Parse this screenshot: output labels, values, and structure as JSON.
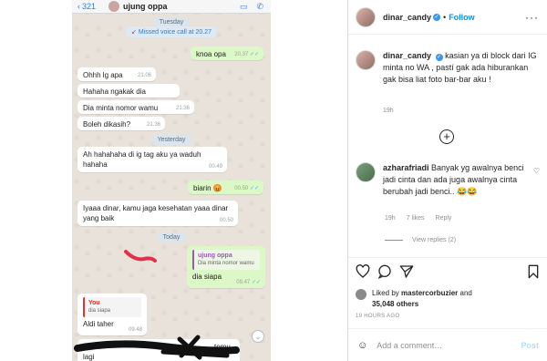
{
  "chat": {
    "back_count": "321",
    "contact_name": "ujung oppa",
    "day_tuesday": "Tuesday",
    "missed_call": "Missed voice call at 20.27",
    "messages": [
      {
        "text": "knoa opa",
        "time": "20.37"
      },
      {
        "text": "Ohhh lg apa",
        "time": "21.06"
      },
      {
        "text": "Hahaha ngakak dia",
        "time": "21.06"
      },
      {
        "text": "Dia minta nomor wamu",
        "time": "21.36"
      },
      {
        "text": "Boleh dikasih?",
        "time": "21.36"
      },
      {
        "text": "Ah hahahaha di ig tag aku ya waduh hahaha",
        "time": "00.49"
      },
      {
        "text": "biarin 😡",
        "time": "00.50"
      },
      {
        "text": "Iyaaa dinar, kamu jaga kesehatan yaaa dinar yang baik",
        "time": "00.50"
      },
      {
        "text": "dia siapa",
        "time": "09.47"
      },
      {
        "text": "Aldi taher",
        "time": "09.48"
      }
    ],
    "day_yesterday": "Yesterday",
    "day_today": "Today",
    "quote_out": {
      "name": "ujung oppa",
      "text": "Dia minta nomor wamu"
    },
    "quote_in": {
      "name": "You",
      "text": "dia siapa"
    },
    "partial_line_1": "To ak",
    "partial_line_1_end": "temu",
    "partial_line_2": "lagi"
  },
  "instagram": {
    "username": "dinar_candy",
    "follow_label": "Follow",
    "caption": "kasian ya di block dari IG minta no WA , pastí gak ada hiburankan gak bisa liat foto bar-bar aku !",
    "caption_time": "19h",
    "comment_user": "azharafriadi",
    "comment_text": "Banyak yg awalnya benci jadi cinta dan ada juga awalnya cinta berubah jadi benci.. 😂😂",
    "comment_time": "19h",
    "comment_likes": "7 likes",
    "reply_label": "Reply",
    "view_replies": "View replies (2)",
    "liked_by_prefix": "Liked by",
    "liked_by_user": "mastercorbuzier",
    "liked_and": "and",
    "liked_count": "35,048 others",
    "post_time": "19 HOURS AGO",
    "add_comment_placeholder": "Add a comment…",
    "post_label": "Post"
  },
  "colors": {
    "accent": "#0095f6",
    "chat_out": "#dcf8c6",
    "verified": "#3897f0"
  }
}
